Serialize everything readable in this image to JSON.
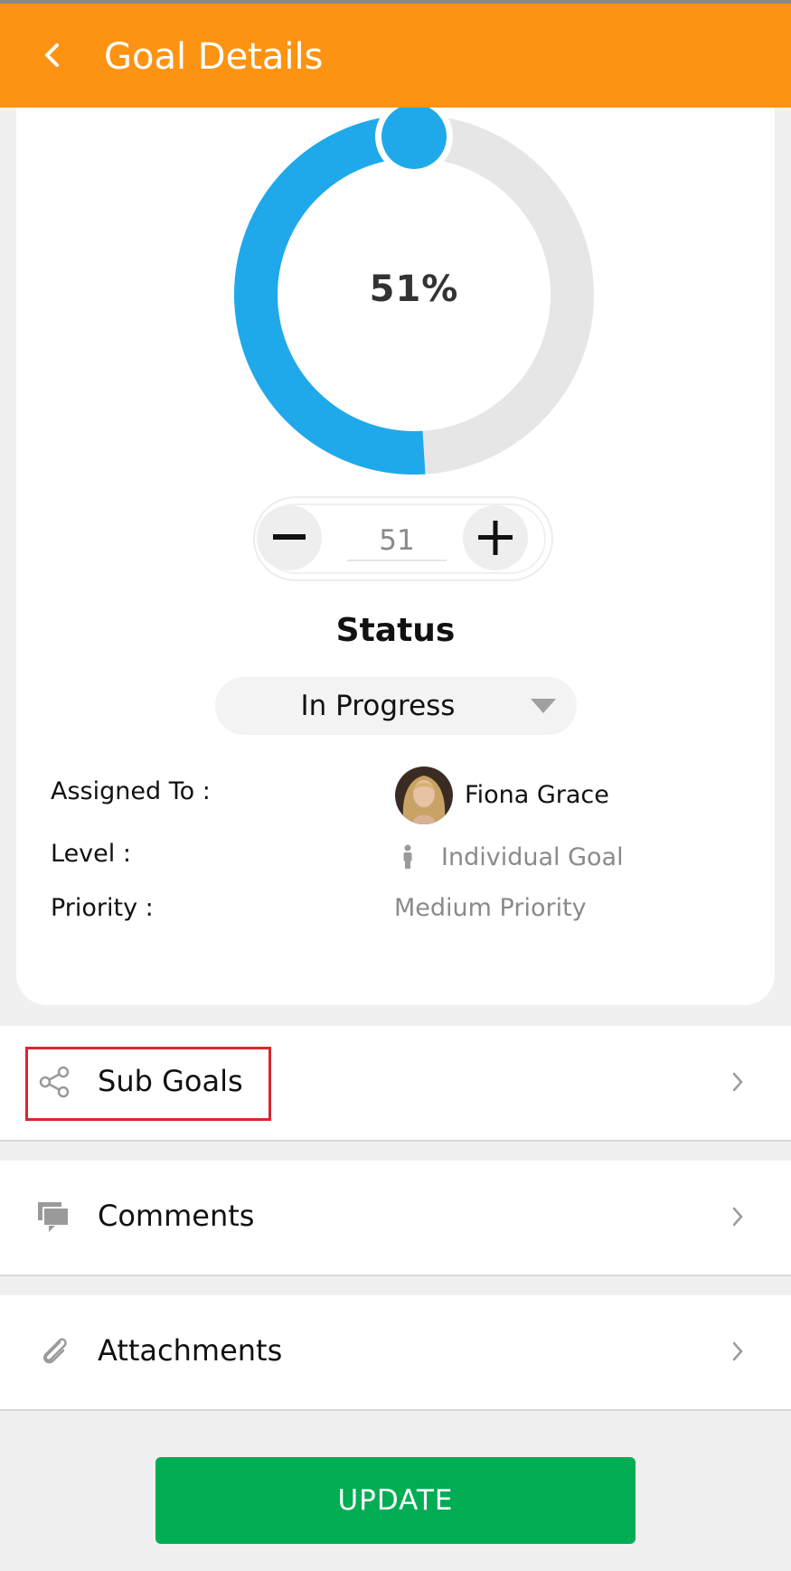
{
  "header": {
    "title": "Goal Details",
    "back_icon": "chevron-left-icon",
    "color": "#fd9312"
  },
  "progress": {
    "percent_label": "51%",
    "value": 51,
    "fill_color": "#1fa9ea",
    "track_color": "#e6e6e6"
  },
  "stepper": {
    "value": "51",
    "minus_icon": "minus-icon",
    "plus_icon": "plus-icon"
  },
  "status": {
    "title": "Status",
    "selected": "In Progress"
  },
  "details": {
    "assigned_label": "Assigned To :",
    "assigned_name": "Fiona  Grace",
    "level_label": "Level :",
    "level_value": "Individual Goal",
    "priority_label": "Priority :",
    "priority_value": "Medium Priority"
  },
  "nav": {
    "sub_goals": "Sub Goals",
    "comments": "Comments",
    "attachments": "Attachments"
  },
  "actions": {
    "update": "UPDATE",
    "update_color": "#00ad53"
  }
}
